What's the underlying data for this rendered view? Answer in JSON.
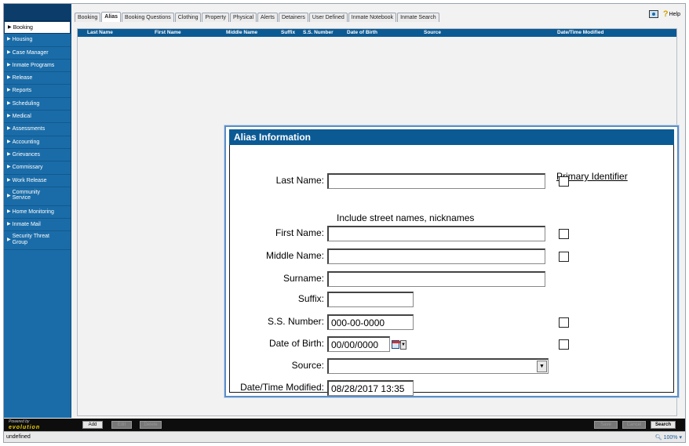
{
  "sidebar": {
    "items": [
      {
        "label": "Booking",
        "active": true
      },
      {
        "label": "Housing"
      },
      {
        "label": "Case Manager"
      },
      {
        "label": "Inmate Programs"
      },
      {
        "label": "Release"
      },
      {
        "label": "Reports"
      },
      {
        "label": "Scheduling"
      },
      {
        "label": "Medical"
      },
      {
        "label": "Assessments"
      },
      {
        "label": "Accounting"
      },
      {
        "label": "Grievances"
      },
      {
        "label": "Commissary"
      },
      {
        "label": "Work Release"
      },
      {
        "label": "Community Service"
      },
      {
        "label": "Home Monitoring"
      },
      {
        "label": "Inmate Mail"
      },
      {
        "label": "Security Threat Group"
      }
    ]
  },
  "tabs": [
    "Booking",
    "Alias",
    "Booking Questions",
    "Clothing",
    "Property",
    "Physical",
    "Alerts",
    "Detainers",
    "User Defined",
    "Inmate Notebook",
    "Inmate Search"
  ],
  "active_tab": "Alias",
  "topbar": {
    "help_label": "Help",
    "help_icon": "help-icon",
    "photo_icon": "photo-icon"
  },
  "grid": {
    "columns": [
      "Last Name",
      "First Name",
      "Middle Name",
      "Suffix",
      "S.S. Number",
      "Date of Birth",
      "Source",
      "Date/Time Modified"
    ]
  },
  "modal": {
    "title": "Alias Information",
    "primary_identifier_label": "Primary Identifier",
    "hint": "Include street names, nicknames",
    "fields": {
      "last_name": {
        "label": "Last Name:",
        "value": "",
        "primary": false
      },
      "first_name": {
        "label": "First Name:",
        "value": "",
        "primary": false
      },
      "middle_name": {
        "label": "Middle Name:",
        "value": "",
        "primary": false
      },
      "surname": {
        "label": "Surname:",
        "value": ""
      },
      "suffix": {
        "label": "Suffix:",
        "value": ""
      },
      "ss_number": {
        "label": "S.S. Number:",
        "value": "000-00-0000",
        "primary": false
      },
      "dob": {
        "label": "Date of Birth:",
        "value": "00/00/0000",
        "primary": false
      },
      "source": {
        "label": "Source:",
        "value": ""
      },
      "modified": {
        "label": "Date/Time Modified:",
        "value": "08/28/2017 13:35"
      }
    }
  },
  "bottom": {
    "powered_by": "Powered by",
    "logo_text": "evolution",
    "add": "Add",
    "edit": "Edit",
    "delete": "Delete",
    "save": "Save",
    "cancel": "Cancel",
    "search": "Search"
  },
  "status": {
    "text": "undefined",
    "zoom": "100%"
  },
  "colors": {
    "sidebar": "#1a6ca8",
    "header": "#0b5a94",
    "modal_border": "#5b8ec6"
  }
}
